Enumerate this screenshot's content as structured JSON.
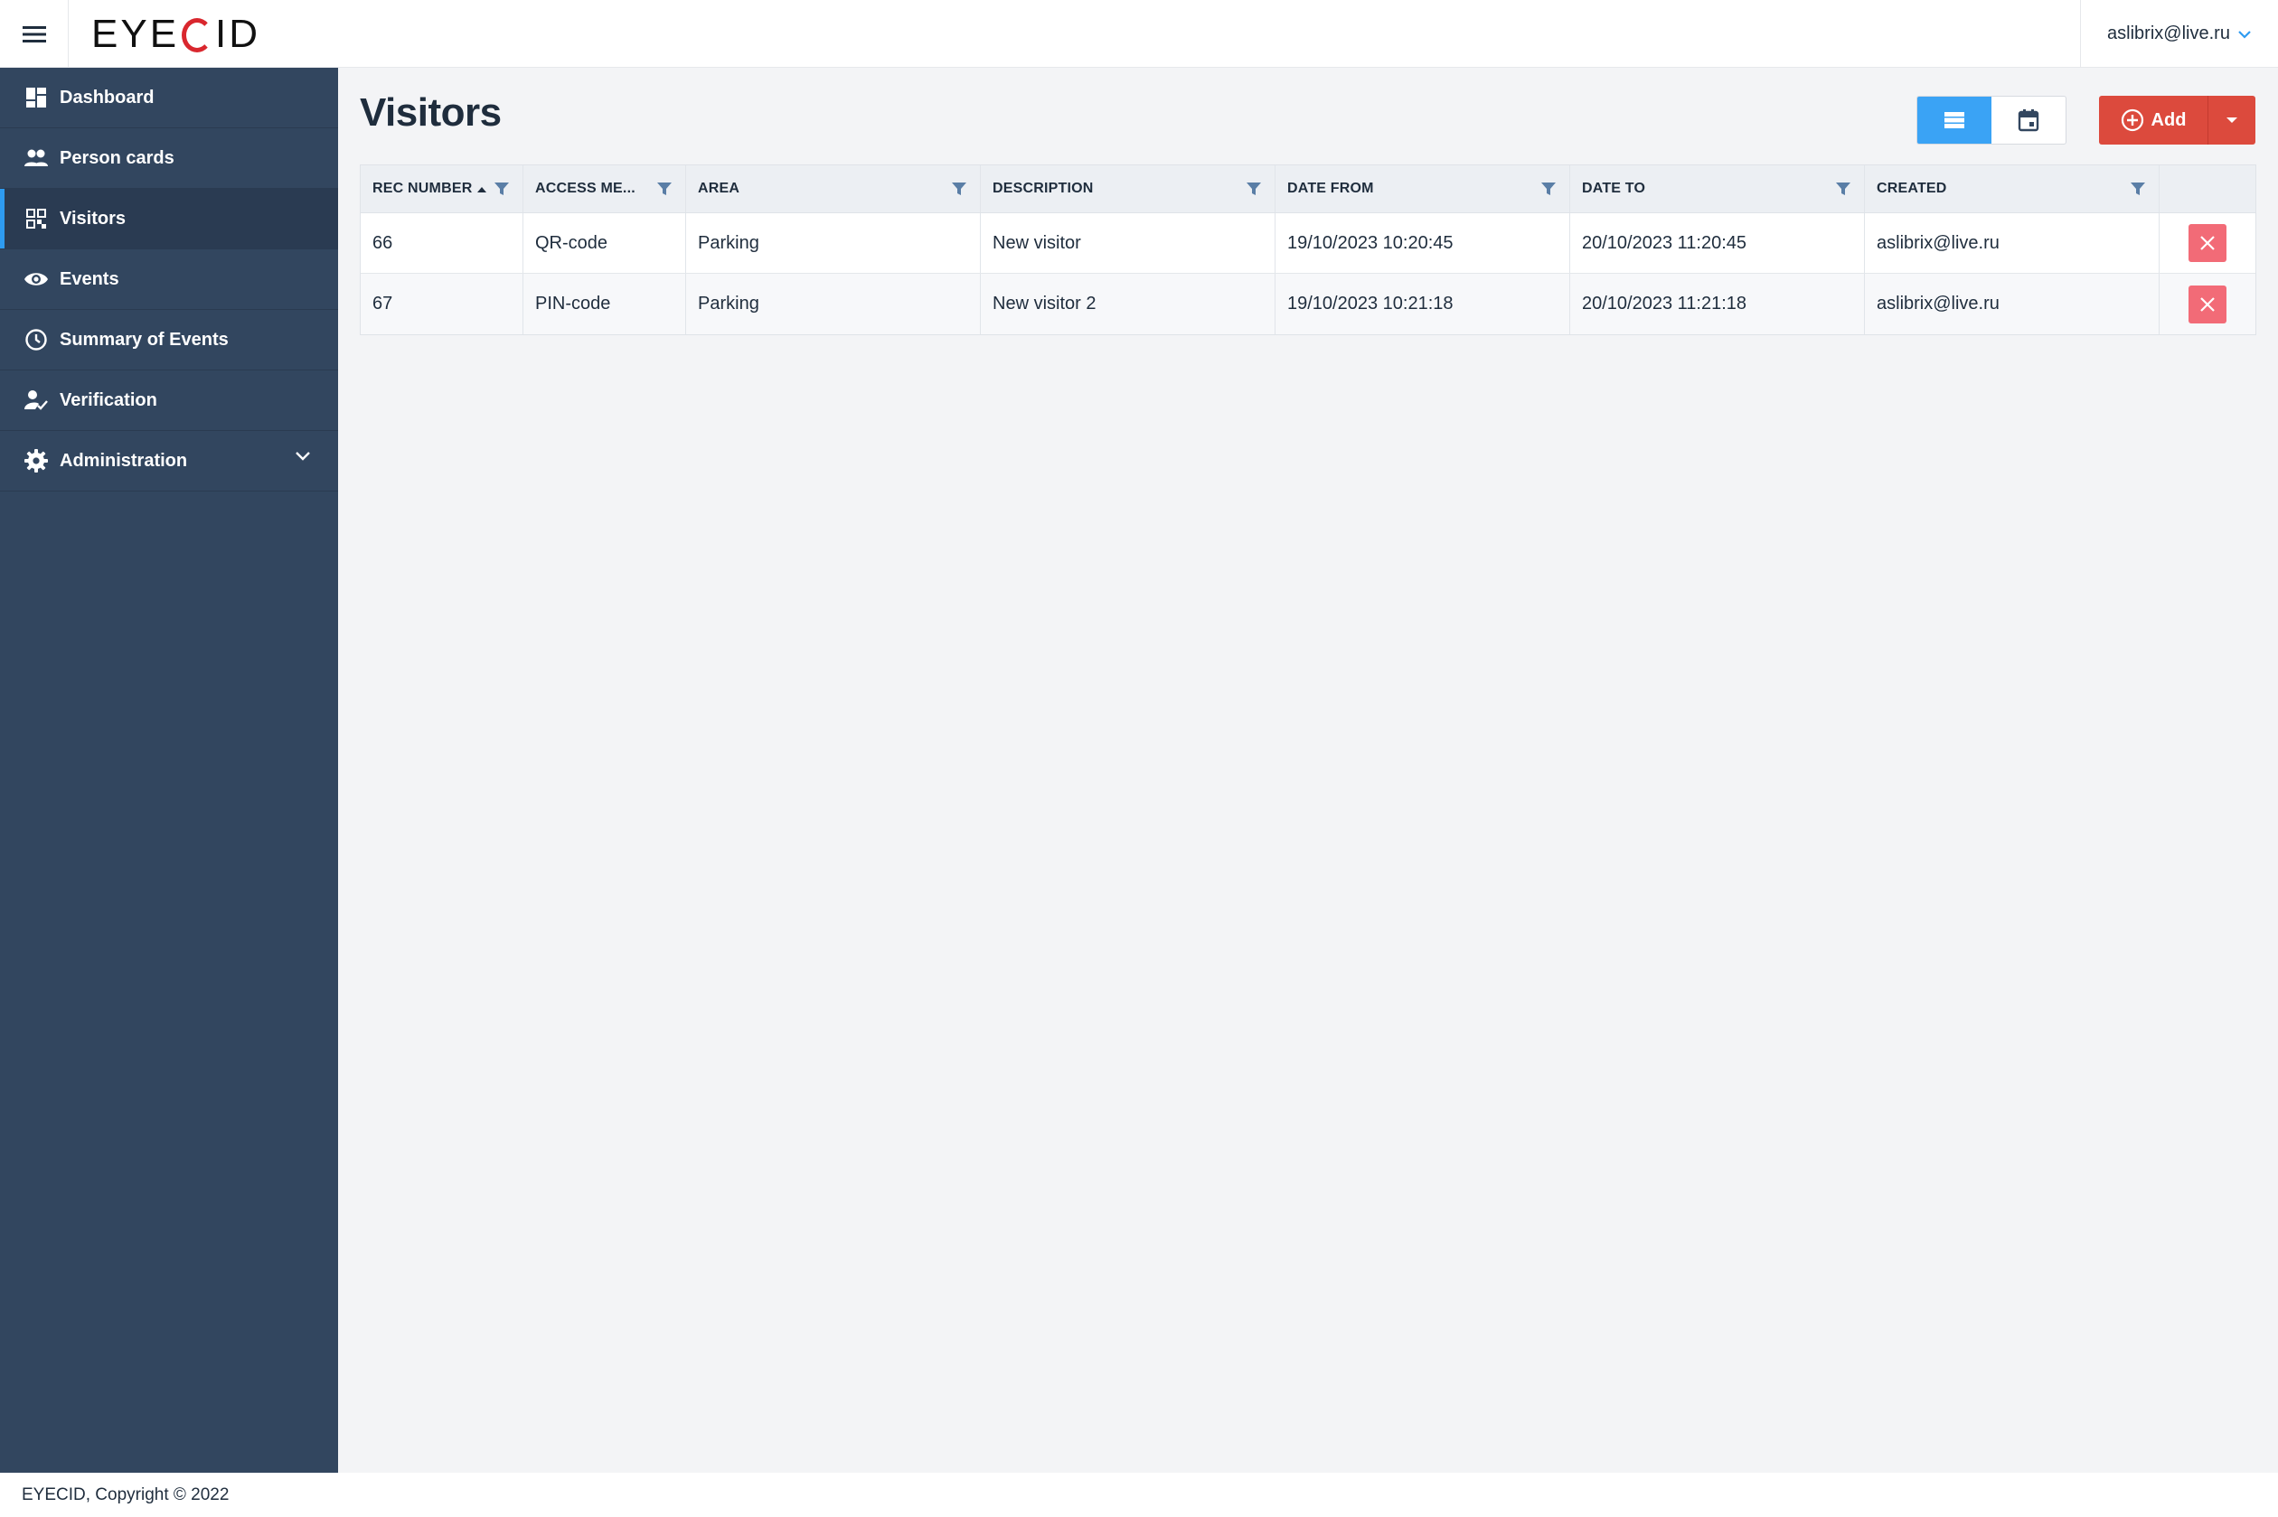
{
  "header": {
    "logo_text_left": "EYE",
    "logo_text_right": "ID",
    "user_email": "aslibrix@live.ru"
  },
  "sidebar": {
    "items": [
      {
        "label": "Dashboard",
        "icon": "dashboard-icon"
      },
      {
        "label": "Person cards",
        "icon": "people-icon"
      },
      {
        "label": "Visitors",
        "icon": "qr-code-icon",
        "active": true
      },
      {
        "label": "Events",
        "icon": "eye-icon"
      },
      {
        "label": "Summary of Events",
        "icon": "clock-icon"
      },
      {
        "label": "Verification",
        "icon": "person-check-icon"
      },
      {
        "label": "Administration",
        "icon": "gear-icon",
        "expandable": true
      }
    ]
  },
  "main": {
    "title": "Visitors",
    "add_label": "Add",
    "accent": "#3aa3f5",
    "danger": "#dc4a3d"
  },
  "table": {
    "columns": [
      "REC NUMBER",
      "ACCESS ME...",
      "AREA",
      "DESCRIPTION",
      "DATE FROM",
      "DATE TO",
      "CREATED"
    ],
    "sorted_column": "REC NUMBER",
    "sort_direction": "ascending",
    "rows": [
      {
        "rec_number": "66",
        "access_method": "QR-code",
        "area": "Parking",
        "description": "New visitor",
        "date_from": "19/10/2023 10:20:45",
        "date_to": "20/10/2023 11:20:45",
        "created": "aslibrix@live.ru"
      },
      {
        "rec_number": "67",
        "access_method": "PIN-code",
        "area": "Parking",
        "description": "New visitor 2",
        "date_from": "19/10/2023 10:21:18",
        "date_to": "20/10/2023 11:21:18",
        "created": "aslibrix@live.ru"
      }
    ]
  },
  "footer": {
    "text": "EYECID, Copyright © 2022"
  }
}
